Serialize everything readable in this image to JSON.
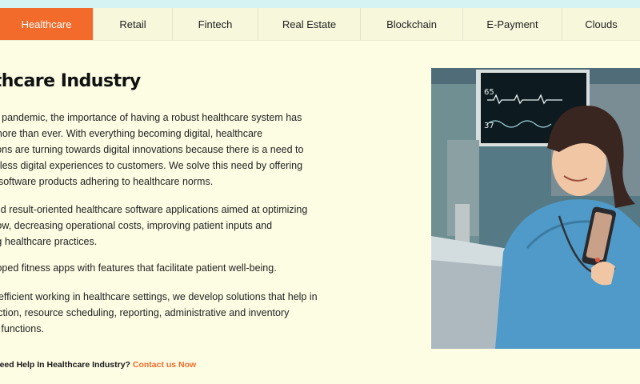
{
  "tabs": [
    {
      "label": "Healthcare",
      "active": true
    },
    {
      "label": "Retail",
      "active": false
    },
    {
      "label": "Fintech",
      "active": false
    },
    {
      "label": "Real Estate",
      "active": false
    },
    {
      "label": "Blockchain",
      "active": false
    },
    {
      "label": "E-Payment",
      "active": false
    },
    {
      "label": "Clouds",
      "active": false
    }
  ],
  "section": {
    "title": "Healthcare Industry",
    "paragraphs": [
      [
        "Due to the pandemic, the importance of having a robust healthcare system has",
        "been felt more than ever. With everything becoming digital, healthcare",
        "organizations are turning towards digital innovations because there is a need to",
        "offer seamless digital experiences to customers. We solve this need by offering",
        "compliant software products adhering to healthcare norms."
      ],
      [
        "We build and result-oriented healthcare software applications aimed at optimizing",
        "their workflow, decreasing operational costs, improving patient inputs and",
        "streamlining healthcare practices."
      ],
      [
        "We've developed fitness apps with features that facilitate patient well-being."
      ],
      [
        "For enabling efficient working in healthcare settings, we develop solutions that help in",
        "patient interaction, resource scheduling, reporting, administrative and inventory",
        "management functions."
      ]
    ],
    "cta_question": "Need Help In Healthcare Industry?",
    "cta_link": "Contact us Now"
  },
  "monitor": {
    "readout_top": "65",
    "readout_bottom": "37"
  },
  "colors": {
    "accent": "#f26b2a",
    "background": "#fdfde4",
    "topbar": "#d6f3f3"
  }
}
